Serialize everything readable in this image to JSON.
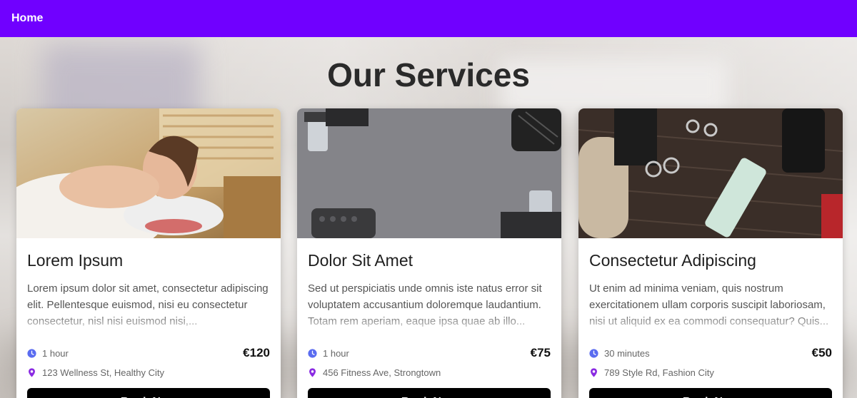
{
  "nav": {
    "home_label": "Home"
  },
  "page": {
    "title": "Our Services"
  },
  "colors": {
    "nav_bg": "#7000ff",
    "clock_icon": "#5a6cf0",
    "pin_icon": "#8a2be2"
  },
  "services": [
    {
      "title": "Lorem Ipsum",
      "description": "Lorem ipsum dolor sit amet, consectetur adipiscing elit. Pellentesque euismod, nisi eu consectetur consectetur, nisl nisi euismod nisi,...",
      "duration": "1 hour",
      "price": "€120",
      "location": "123 Wellness St, Healthy City",
      "button_label": "Book Now",
      "image": "spa-massage-photo"
    },
    {
      "title": "Dolor Sit Amet",
      "description": "Sed ut perspiciatis unde omnis iste natus error sit voluptatem accusantium doloremque laudantium. Totam rem aperiam, eaque ipsa quae ab illo...",
      "duration": "1 hour",
      "price": "€75",
      "location": "456 Fitness Ave, Strongtown",
      "button_label": "Book Now",
      "image": "fitness-dumbbells-photo"
    },
    {
      "title": "Consectetur Adipiscing",
      "description": "Ut enim ad minima veniam, quis nostrum exercitationem ullam corporis suscipit laboriosam, nisi ut aliquid ex ea commodi consequatur? Quis...",
      "duration": "30 minutes",
      "price": "€50",
      "location": "789 Style Rd, Fashion City",
      "button_label": "Book Now",
      "image": "barber-tools-photo"
    }
  ]
}
